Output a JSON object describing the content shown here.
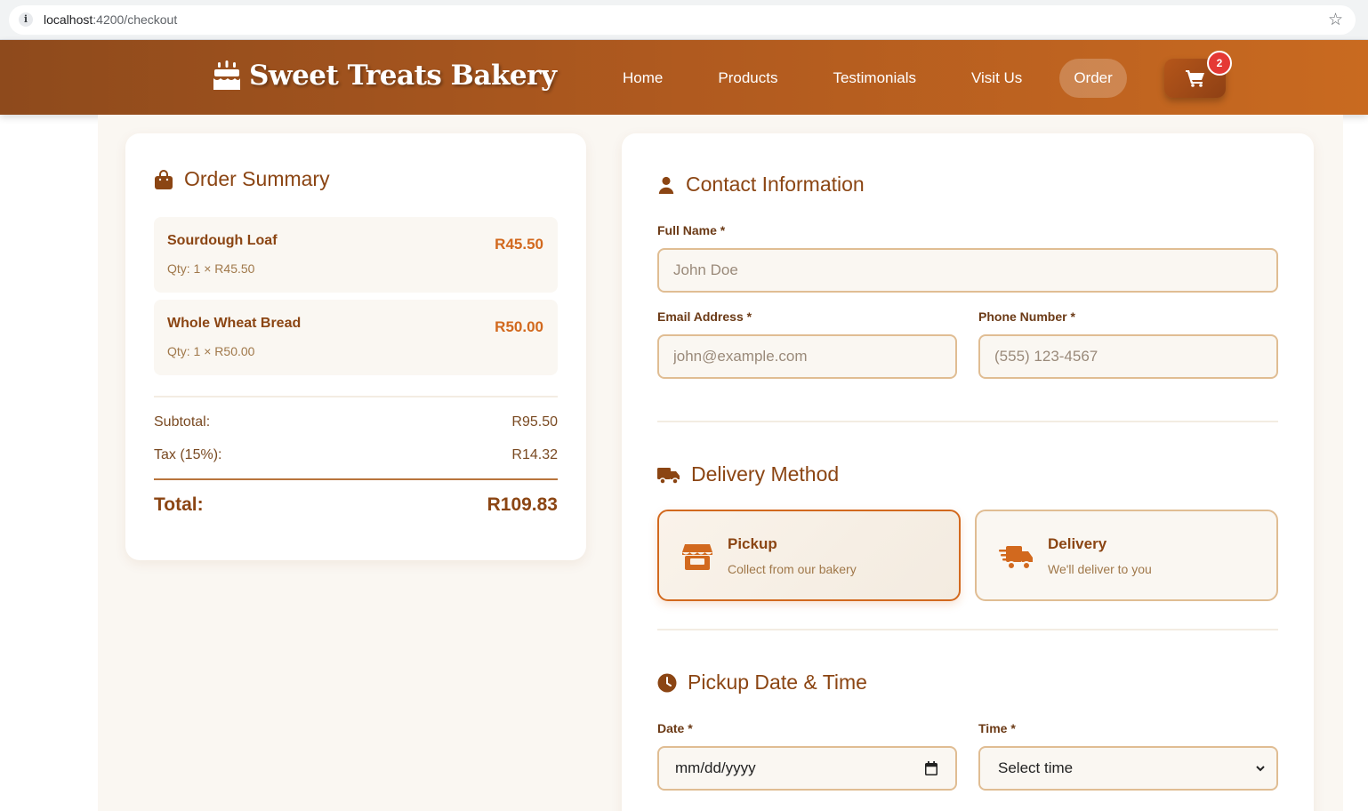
{
  "browser": {
    "url_host": "localhost",
    "url_path": ":4200/checkout"
  },
  "header": {
    "logo_text": "Sweet Treats Bakery",
    "logo_icon": "birthday-cake-icon",
    "nav": [
      "Home",
      "Products",
      "Testimonials",
      "Visit Us",
      "Order"
    ],
    "active_nav": "Order",
    "cart_count": "2"
  },
  "summary": {
    "title": "Order Summary",
    "items": [
      {
        "name": "Sourdough Loaf",
        "qty": "Qty: 1 × R45.50",
        "price": "R45.50"
      },
      {
        "name": "Whole Wheat Bread",
        "qty": "Qty: 1 × R50.00",
        "price": "R50.00"
      }
    ],
    "subtotal_label": "Subtotal:",
    "subtotal_value": "R95.50",
    "tax_label": "Tax (15%):",
    "tax_value": "R14.32",
    "total_label": "Total:",
    "total_value": "R109.83"
  },
  "contact": {
    "title": "Contact Information",
    "full_name_label": "Full Name *",
    "full_name_placeholder": "John Doe",
    "email_label": "Email Address *",
    "email_placeholder": "john@example.com",
    "phone_label": "Phone Number *",
    "phone_placeholder": "(555) 123-4567"
  },
  "delivery": {
    "title": "Delivery Method",
    "options": [
      {
        "title": "Pickup",
        "desc": "Collect from our bakery",
        "selected": true
      },
      {
        "title": "Delivery",
        "desc": "We'll deliver to you",
        "selected": false
      }
    ]
  },
  "schedule": {
    "title": "Pickup Date & Time",
    "date_label": "Date *",
    "date_value": "mm/dd/yyyy",
    "time_label": "Time *",
    "time_value": "Select time"
  },
  "colors": {
    "brand": "#8b4513",
    "accent": "#d2691e",
    "badge": "#e53935"
  }
}
